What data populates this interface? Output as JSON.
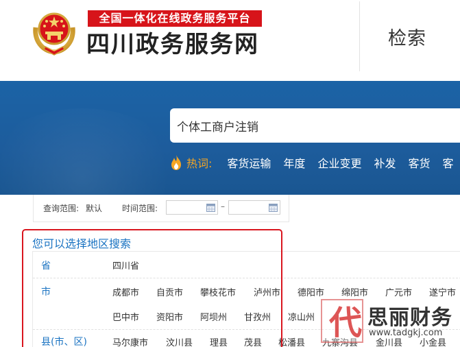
{
  "header": {
    "slogan": "全国一体化在线政务服务平台",
    "site_title": "四川政务服务网",
    "search_title": "检索"
  },
  "banner": {
    "search_value": "个体工商户注销",
    "hot_label": "热词:",
    "hot_words": [
      "客货运输",
      "年度",
      "企业变更",
      "补发",
      "客货",
      "客"
    ]
  },
  "filter": {
    "scope_label": "查询范围:",
    "scope_value": "默认",
    "time_label": "时间范围:",
    "start_date": "",
    "end_date": "",
    "separator": "–"
  },
  "region": {
    "title": "您可以选择地区搜索",
    "province_label": "省",
    "province_value": "四川省",
    "city_label": "市",
    "cities_row1": [
      "成都市",
      "自贡市",
      "攀枝花市",
      "泸州市",
      "德阳市",
      "绵阳市",
      "广元市",
      "遂宁市"
    ],
    "cities_row2": [
      "巴中市",
      "资阳市",
      "阿坝州",
      "甘孜州",
      "凉山州"
    ],
    "county_label": "县(市、区)",
    "counties": [
      "马尔康市",
      "汶川县",
      "理县",
      "茂县",
      "松潘县",
      "九寨沟县",
      "金川县",
      "小金县"
    ]
  },
  "watermark": {
    "glyph": "代",
    "brand": "思丽财务",
    "url": "www.tadgkj.com"
  },
  "colors": {
    "slogan_bg": "#d7141a",
    "banner_blue": "#1d5c9c",
    "link_blue": "#1a73c2",
    "hot_orange": "#f6a623",
    "highlight_red": "#d9151e"
  }
}
